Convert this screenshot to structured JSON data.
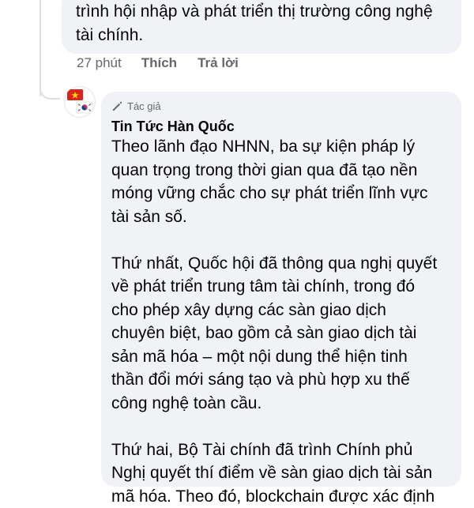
{
  "previous_comment": {
    "text": "trình hội nhập và phát triển thị trường công nghệ\ntài chính."
  },
  "actions": {
    "time": "27 phút",
    "like_label": "Thích",
    "reply_label": "Trả lời"
  },
  "comment": {
    "badge_label": "Tác giả",
    "badge_icon": "pencil-icon",
    "author_name": "Tin Tức Hàn Quốc",
    "avatar": "vietnam-korea-flags-avatar",
    "paragraphs": [
      "Theo lãnh đạo NHNN, ba sự kiện pháp lý\nquan trọng trong thời gian qua đã tạo nền\nmóng vững chắc cho sự phát triển lĩnh vực\ntài sản số.",
      "Thứ nhất, Quốc hội đã thông qua nghị quyết\nvề phát triển trung tâm tài chính, trong đó\ncho phép xây dựng các sàn giao dịch\nchuyên biệt, bao gồm cả sàn giao dịch tài\nsản mã hóa – một nội dung thể hiện tinh\nthần đổi mới sáng tạo và phù hợp xu thế\ncông nghệ toàn cầu.",
      "Thứ hai, Bộ Tài chính đã trình Chính phủ\nNghị quyết thí điểm về sàn giao dịch tài sản\nmã hóa. Theo đó, blockchain được xác định"
    ]
  },
  "colors": {
    "bubble_bg": "#f0f2f5",
    "text_primary": "#050505",
    "text_secondary": "#65676b",
    "thread_line": "#dcdfe4"
  }
}
